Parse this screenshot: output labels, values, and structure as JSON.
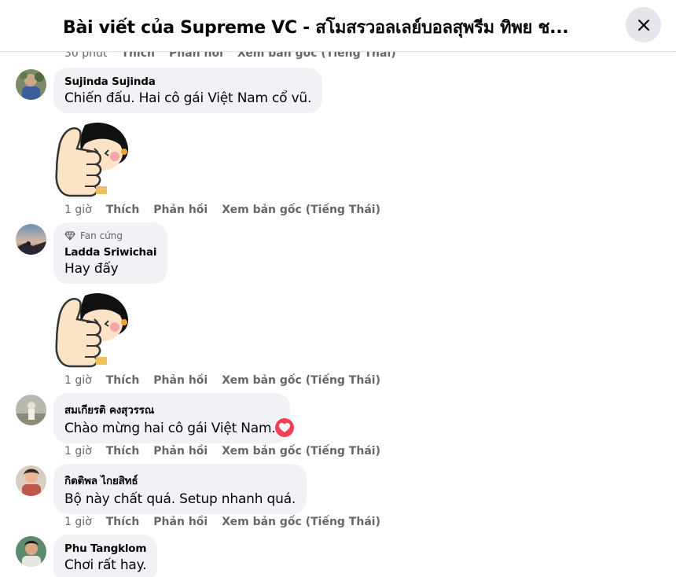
{
  "header": {
    "title": "Bài viết của Supreme VC - สโมสรวอลเลย์บอลสุพรีม ทิพย ช...",
    "close_label": "✕"
  },
  "top_partial_actions": {
    "time": "30 phút",
    "like": "Thích",
    "reply": "Phản hồi",
    "translate": "Xem bản gốc (Tiếng Thái)"
  },
  "comments": [
    {
      "author": "Sujinda Sujinda",
      "text": "Chiến đấu. Hai cô gái Việt Nam cổ vũ.",
      "has_sticker": true,
      "sticker": "thumbs-up-girl-sticker",
      "time": "1 giờ",
      "like": "Thích",
      "reply": "Phản hồi",
      "translate": "Xem bản gốc (Tiếng Thái)"
    },
    {
      "badge": "Fan cứng",
      "author": "Ladda Sriwichai",
      "text": "Hay đấy",
      "has_sticker": true,
      "sticker": "thumbs-up-girl-sticker",
      "time": "1 giờ",
      "like": "Thích",
      "reply": "Phản hồi",
      "translate": "Xem bản gốc (Tiếng Thái)"
    },
    {
      "author": "สมเกียรติ คงสุวรรณ",
      "text": "Chào mừng hai cô gái Việt Nam.",
      "reaction": "love-heart-icon",
      "time": "1 giờ",
      "like": "Thích",
      "reply": "Phản hồi",
      "translate": "Xem bản gốc (Tiếng Thái)"
    },
    {
      "author": "กิตติพล ไกยสิทธ์",
      "text": "Bộ này chất quá. Setup nhanh quá.",
      "time": "1 giờ",
      "like": "Thích",
      "reply": "Phản hồi",
      "translate": "Xem bản gốc (Tiếng Thái)"
    },
    {
      "author": "Phu Tangklom",
      "text": "Chơi rất hay."
    }
  ],
  "colors": {
    "bubble": "#f0f2f5",
    "meta_text": "#65676b",
    "heart": "#f33e58",
    "close_bg": "#e4e6eb"
  }
}
